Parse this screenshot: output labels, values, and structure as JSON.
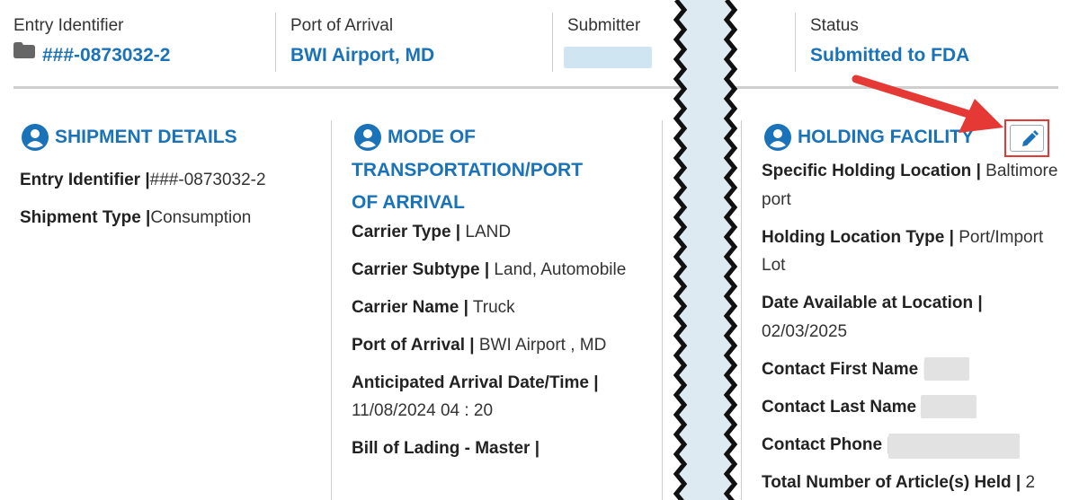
{
  "header": {
    "entry_identifier": {
      "label": "Entry Identifier",
      "value": "###-0873032-2"
    },
    "port_of_arrival": {
      "label": "Port of Arrival",
      "value": "BWI Airport, MD"
    },
    "submitter": {
      "label": "Submitter"
    },
    "status": {
      "label": "Status",
      "value": "Submitted to FDA"
    }
  },
  "shipment_details": {
    "title": "SHIPMENT DETAILS",
    "fields": [
      {
        "label": "Entry Identifier |",
        "value": "###-0873032-2"
      },
      {
        "label": "Shipment Type |",
        "value": "Consumption"
      }
    ]
  },
  "mode_of_transport": {
    "title_lines": [
      "MODE OF",
      "TRANSPORTATION/PORT",
      "OF ARRIVAL"
    ],
    "fields": [
      {
        "label": "Carrier Type |",
        "value": " LAND"
      },
      {
        "label": "Carrier Subtype |",
        "value": " Land, Automobile"
      },
      {
        "label": "Carrier Name |",
        "value": " Truck"
      },
      {
        "label": "Port of Arrival |",
        "value": " BWI Airport , MD"
      },
      {
        "label": "Anticipated Arrival Date/Time |",
        "value": "11/08/2024 04 : 20"
      },
      {
        "label": "Bill of Lading - Master |",
        "value": ""
      }
    ]
  },
  "holding_facility": {
    "title": "HOLDING FACILITY",
    "fields": [
      {
        "label": "Specific Holding Location |",
        "value1": " Baltimore",
        "value2": "port"
      },
      {
        "label": "Holding Location Type |",
        "value1": " Port/Import",
        "value2": "Lot"
      },
      {
        "label": "Date Available at Location |",
        "value2": "02/03/2025"
      },
      {
        "label": "Contact First Name |"
      },
      {
        "label": "Contact Last Name |"
      },
      {
        "label": "Contact Phone |"
      },
      {
        "label": "Total Number of Article(s) Held |",
        "value1": " 2"
      }
    ]
  },
  "colors": {
    "accent": "#1a73b8",
    "annotation": "#e53935"
  },
  "icons": {
    "folder": "folder-icon",
    "person": "person-icon",
    "edit": "pencil-icon"
  }
}
